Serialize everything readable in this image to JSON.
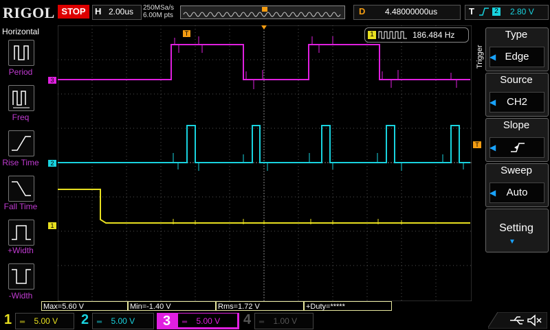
{
  "top_bar": {
    "logo": "RIGOL",
    "run_state": "STOP",
    "horizontal_letter": "H",
    "timebase": "2.00us",
    "sample_rate": "250MSa/s",
    "memory_depth": "6.00M pts",
    "delay_letter": "D",
    "delay_value": "4.48000000us",
    "trigger_letter": "T",
    "trigger_source": "2",
    "trigger_level": "2.80 V"
  },
  "left_menu": {
    "title": "Horizontal",
    "items": [
      {
        "label": "Period",
        "icon": "period-icon"
      },
      {
        "label": "Freq",
        "icon": "freq-icon"
      },
      {
        "label": "Rise Time",
        "icon": "rise-time-icon"
      },
      {
        "label": "Fall Time",
        "icon": "fall-time-icon"
      },
      {
        "label": "+Width",
        "icon": "pos-width-icon"
      },
      {
        "label": "-Width",
        "icon": "neg-width-icon"
      }
    ]
  },
  "counter": {
    "channel": "1",
    "value": "186.484 Hz"
  },
  "right_menu": {
    "title": "Trigger",
    "items": [
      {
        "title": "Type",
        "value": "Edge"
      },
      {
        "title": "Source",
        "value": "CH2"
      },
      {
        "title": "Slope",
        "value": ""
      },
      {
        "title": "Sweep",
        "value": "Auto"
      }
    ],
    "setting": "Setting"
  },
  "markers": {
    "ch3": "3",
    "ch2": "2",
    "ch1": "1",
    "trigger": "T"
  },
  "measurements": {
    "max": "Max=5.60 V",
    "min": "Min=-1.40 V",
    "rms": "Rms=1.72 V",
    "duty": "+Duty=*****"
  },
  "channels": [
    {
      "num": "1",
      "scale": "5.00 V",
      "color": "#e8e020"
    },
    {
      "num": "2",
      "scale": "5.00 V",
      "color": "#19d3df"
    },
    {
      "num": "3",
      "scale": "5.00 V",
      "color": "#e020e0"
    },
    {
      "num": "4",
      "scale": "1.00 V",
      "color": "#555555"
    }
  ],
  "colors": {
    "ch1": "#e8e020",
    "ch2": "#19d3df",
    "ch3": "#e020e0",
    "trigger": "#f39c12",
    "accent": "#19a3ff"
  }
}
